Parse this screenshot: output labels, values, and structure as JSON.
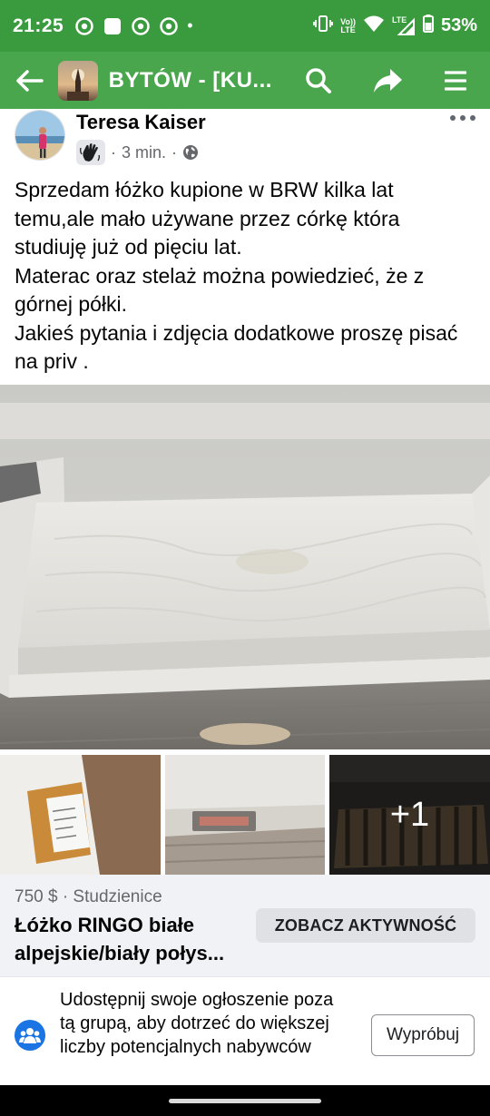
{
  "status_bar": {
    "time": "21:25",
    "dot": "•",
    "volte": "Vo))",
    "lte_label": "LTE",
    "network": "LTE",
    "battery": "53%",
    "icons": [
      "chrome-icon",
      "square-icon",
      "chrome-icon",
      "chrome-icon",
      "vibrate-icon",
      "wifi-icon",
      "signal-icon",
      "battery-icon"
    ]
  },
  "app_bar": {
    "title": "BYTÓW  - [KU...",
    "back_icon": "arrow-left-icon",
    "search_icon": "search-icon",
    "share_icon": "share-icon",
    "menu_icon": "menu-icon"
  },
  "post": {
    "author": "Teresa Kaiser",
    "time": "3 min.",
    "separator": "·",
    "badge_icon": "waving-hand-icon",
    "privacy_icon": "globe-icon",
    "text_lines": [
      "Sprzedam łóżko kupione w BRW kilka lat temu,ale mało używane przez córkę która studiuję już od pięciu lat.",
      "Materac oraz stelaż można powiedzieć, że z górnej półki.",
      "Jakieś pytania i zdjęcia dodatkowe proszę pisać na priv ."
    ],
    "more_photos": "+1"
  },
  "listing": {
    "price_location": "750 $ · Studzienice",
    "title": "Łóżko RINGO białe alpejskie/biały połys...",
    "activity_button": "ZOBACZ AKTYWNOŚĆ"
  },
  "promo": {
    "text": "Udostępnij swoje ogłoszenie poza tą grupą, aby dotrzeć do większej liczby potencjalnych nabywców",
    "button": "Wypróbuj",
    "icon": "group-icon"
  },
  "colors": {
    "status_bar": "#3a9a3e",
    "app_bar": "#4aa64d",
    "secondary_text": "#65676b",
    "listing_bg": "#f0f2f5",
    "accent_blue": "#1b74e4"
  }
}
